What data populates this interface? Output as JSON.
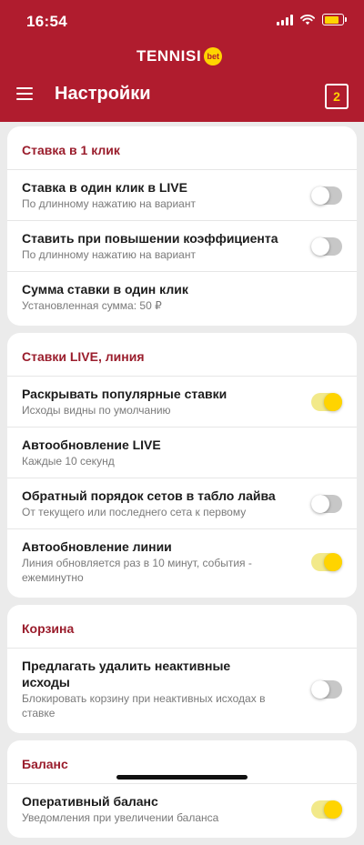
{
  "status_bar": {
    "time": "16:54",
    "signal_icon": "signal-icon",
    "wifi_icon": "wifi-icon",
    "battery_icon": "battery-icon",
    "battery_level": 0.8,
    "battery_color": "#ffd400"
  },
  "header": {
    "logo_text": "TENNISI",
    "logo_badge": "bet",
    "title": "Настройки",
    "menu_icon": "hamburger-menu-icon",
    "coupon_icon": "coupon-icon",
    "coupon_count": "2",
    "background_color": "#b01c2e",
    "accent_color": "#ffd400"
  },
  "sections": [
    {
      "title": "Ставка в 1 клик",
      "rows": [
        {
          "title": "Ставка в один клик в LIVE",
          "subtitle": "По длинному нажатию на вариант",
          "toggle": "off"
        },
        {
          "title": "Ставить при повышении коэффициента",
          "subtitle": "По длинному нажатию на вариант",
          "toggle": "off"
        },
        {
          "title": "Сумма ставки в один клик",
          "subtitle": "Установленная сумма: 50 ₽"
        }
      ]
    },
    {
      "title": "Ставки LIVE, линия",
      "rows": [
        {
          "title": "Раскрывать популярные ставки",
          "subtitle": "Исходы видны по умолчанию",
          "toggle": "on"
        },
        {
          "title": "Автообновление LIVE",
          "subtitle": "Каждые 10 секунд"
        },
        {
          "title": "Обратный порядок сетов в табло лайва",
          "subtitle": "От текущего или последнего сета к первому",
          "toggle": "off"
        },
        {
          "title": "Автообновление линии",
          "subtitle": "Линия обновляется раз в 10 минут, события - ежеминутно",
          "toggle": "on"
        }
      ]
    },
    {
      "title": "Корзина",
      "rows": [
        {
          "title": "Предлагать удалить неактивные исходы",
          "subtitle": "Блокировать корзину при неактивных исходах в ставке",
          "toggle": "off"
        }
      ]
    },
    {
      "title": "Баланс",
      "rows": [
        {
          "title": "Оперативный баланс",
          "subtitle": "Уведомления при увеличении баланса",
          "toggle": "on"
        }
      ]
    }
  ]
}
